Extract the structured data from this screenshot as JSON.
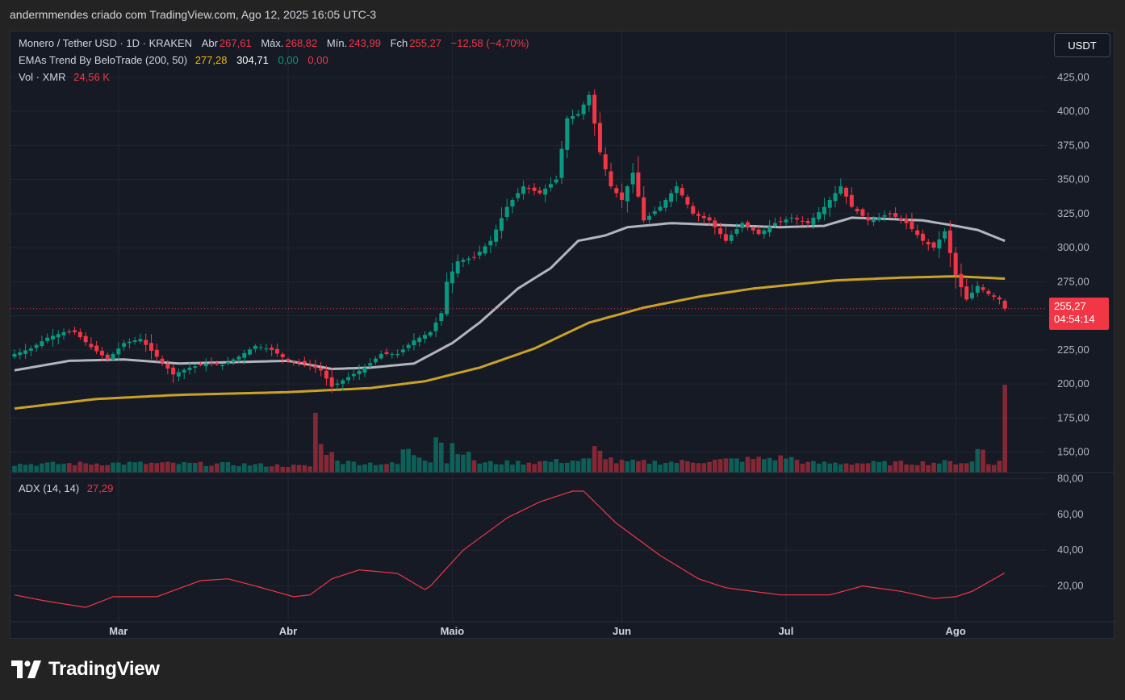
{
  "caption": "andermmendes criado com TradingView.com, Ago 12, 2025 16:05 UTC-3",
  "legend": {
    "symbol": "Monero / Tether USD · 1D · KRAKEN",
    "open_label": "Abr",
    "open_value": "267,61",
    "high_label": "Máx.",
    "high_value": "268,82",
    "low_label": "Mín.",
    "low_value": "243,99",
    "close_label": "Fch",
    "close_value": "255,27",
    "change_value": "−12,58 (−4,70%)",
    "ema_name": "EMAs Trend By BeloTrade (200, 50)",
    "ema_200_value": "277,28",
    "ema_50_value": "304,71",
    "ema_extra_1": "0,00",
    "ema_extra_2": "0,00",
    "vol_label": "Vol · XMR",
    "vol_value": "24,56 K",
    "adx_label": "ADX (14, 14)",
    "adx_value": "27,29"
  },
  "currency_button": "USDT",
  "price_tag": {
    "price": "255,27",
    "countdown": "04:54:14"
  },
  "logo_text": "TradingView",
  "colors": {
    "up": "#089981",
    "down": "#f23645",
    "ema50": "#b2b5be",
    "ema200": "#c9a227",
    "adx": "#f23645",
    "background": "#161a25"
  },
  "chart_data": {
    "type": "candlestick",
    "price_axis": {
      "ylim": [
        135,
        432
      ],
      "ticks": [
        "425,00",
        "400,00",
        "375,00",
        "350,00",
        "325,00",
        "300,00",
        "275,00",
        "250,00",
        "225,00",
        "200,00",
        "175,00",
        "150,00"
      ],
      "tick_values": [
        425,
        400,
        375,
        350,
        325,
        300,
        275,
        250,
        225,
        200,
        175,
        150
      ]
    },
    "adx_axis": {
      "ylim": [
        0,
        82
      ],
      "ticks": [
        "80,00",
        "60,00",
        "40,00",
        "20,00"
      ],
      "tick_values": [
        80,
        60,
        40,
        20
      ]
    },
    "time_axis": {
      "labels": [
        "Mar",
        "Abr",
        "Maio",
        "Jun",
        "Jul",
        "Ago"
      ],
      "label_day_index": [
        19,
        50,
        80,
        111,
        141,
        172
      ]
    },
    "day_count": 182,
    "last_price": 255.27,
    "price_anchors": [
      [
        0,
        222
      ],
      [
        3,
        226
      ],
      [
        6,
        234
      ],
      [
        9,
        238
      ],
      [
        11,
        238
      ],
      [
        14,
        227
      ],
      [
        17,
        218
      ],
      [
        20,
        230
      ],
      [
        23,
        233
      ],
      [
        26,
        220
      ],
      [
        29,
        207
      ],
      [
        32,
        212
      ],
      [
        35,
        215
      ],
      [
        38,
        214
      ],
      [
        41,
        220
      ],
      [
        44,
        228
      ],
      [
        47,
        225
      ],
      [
        50,
        217
      ],
      [
        53,
        215
      ],
      [
        56,
        210
      ],
      [
        58,
        198
      ],
      [
        61,
        205
      ],
      [
        64,
        212
      ],
      [
        67,
        222
      ],
      [
        70,
        222
      ],
      [
        73,
        232
      ],
      [
        76,
        238
      ],
      [
        78,
        252
      ],
      [
        79,
        275
      ],
      [
        81,
        290
      ],
      [
        84,
        293
      ],
      [
        87,
        305
      ],
      [
        90,
        330
      ],
      [
        93,
        345
      ],
      [
        96,
        340
      ],
      [
        99,
        350
      ],
      [
        101,
        395
      ],
      [
        103,
        398
      ],
      [
        105,
        412
      ],
      [
        107,
        370
      ],
      [
        109,
        345
      ],
      [
        111,
        335
      ],
      [
        113,
        355
      ],
      [
        115,
        320
      ],
      [
        118,
        330
      ],
      [
        121,
        345
      ],
      [
        124,
        325
      ],
      [
        127,
        320
      ],
      [
        130,
        305
      ],
      [
        133,
        318
      ],
      [
        136,
        310
      ],
      [
        139,
        318
      ],
      [
        142,
        322
      ],
      [
        145,
        318
      ],
      [
        148,
        330
      ],
      [
        151,
        345
      ],
      [
        153,
        330
      ],
      [
        156,
        320
      ],
      [
        160,
        325
      ],
      [
        163,
        318
      ],
      [
        166,
        305
      ],
      [
        168,
        300
      ],
      [
        170,
        312
      ],
      [
        172,
        280
      ],
      [
        174,
        262
      ],
      [
        176,
        272
      ],
      [
        178,
        266
      ],
      [
        180,
        262
      ],
      [
        181,
        255.27
      ]
    ],
    "volume_anchors": [
      [
        0,
        8
      ],
      [
        20,
        9
      ],
      [
        40,
        8
      ],
      [
        54,
        6
      ],
      [
        55,
        56
      ],
      [
        56,
        25
      ],
      [
        60,
        10
      ],
      [
        70,
        8
      ],
      [
        71,
        22
      ],
      [
        76,
        12
      ],
      [
        77,
        40
      ],
      [
        78,
        30
      ],
      [
        79,
        10
      ],
      [
        80,
        27
      ],
      [
        85,
        9
      ],
      [
        95,
        10
      ],
      [
        105,
        12
      ],
      [
        106,
        22
      ],
      [
        110,
        10
      ],
      [
        121,
        10
      ],
      [
        140,
        14
      ],
      [
        141,
        15
      ],
      [
        145,
        9
      ],
      [
        160,
        9
      ],
      [
        175,
        10
      ],
      [
        176,
        22
      ],
      [
        177,
        22
      ],
      [
        178,
        9
      ],
      [
        180,
        10
      ],
      [
        181,
        84
      ]
    ],
    "ema50_anchors": [
      [
        0,
        210
      ],
      [
        10,
        217
      ],
      [
        20,
        218
      ],
      [
        30,
        215
      ],
      [
        40,
        216
      ],
      [
        50,
        217
      ],
      [
        58,
        211
      ],
      [
        65,
        212
      ],
      [
        73,
        215
      ],
      [
        80,
        230
      ],
      [
        85,
        245
      ],
      [
        92,
        270
      ],
      [
        98,
        285
      ],
      [
        103,
        305
      ],
      [
        108,
        309
      ],
      [
        112,
        315
      ],
      [
        120,
        318
      ],
      [
        140,
        315
      ],
      [
        148,
        316
      ],
      [
        153,
        322
      ],
      [
        160,
        321
      ],
      [
        166,
        320
      ],
      [
        172,
        316
      ],
      [
        176,
        313
      ],
      [
        181,
        305
      ]
    ],
    "ema200_anchors": [
      [
        0,
        182
      ],
      [
        15,
        189
      ],
      [
        30,
        192
      ],
      [
        50,
        194
      ],
      [
        65,
        197
      ],
      [
        75,
        202
      ],
      [
        85,
        212
      ],
      [
        95,
        226
      ],
      [
        105,
        245
      ],
      [
        115,
        256
      ],
      [
        125,
        264
      ],
      [
        135,
        270
      ],
      [
        150,
        276
      ],
      [
        162,
        278
      ],
      [
        172,
        279
      ],
      [
        181,
        277.28
      ]
    ],
    "adx_anchors": [
      [
        0,
        15
      ],
      [
        5,
        12
      ],
      [
        13,
        8
      ],
      [
        18,
        14
      ],
      [
        26,
        14
      ],
      [
        34,
        23
      ],
      [
        39,
        24
      ],
      [
        44,
        20
      ],
      [
        51,
        14
      ],
      [
        54,
        15
      ],
      [
        58,
        24
      ],
      [
        63,
        29
      ],
      [
        70,
        27
      ],
      [
        75,
        18
      ],
      [
        76,
        20
      ],
      [
        82,
        40
      ],
      [
        90,
        58
      ],
      [
        96,
        67
      ],
      [
        102,
        73
      ],
      [
        104,
        73
      ],
      [
        110,
        55
      ],
      [
        118,
        37
      ],
      [
        125,
        24
      ],
      [
        130,
        19
      ],
      [
        140,
        15
      ],
      [
        149,
        15
      ],
      [
        155,
        20
      ],
      [
        162,
        17
      ],
      [
        168,
        13
      ],
      [
        172,
        14
      ],
      [
        175,
        17
      ],
      [
        181,
        27.29
      ]
    ]
  }
}
